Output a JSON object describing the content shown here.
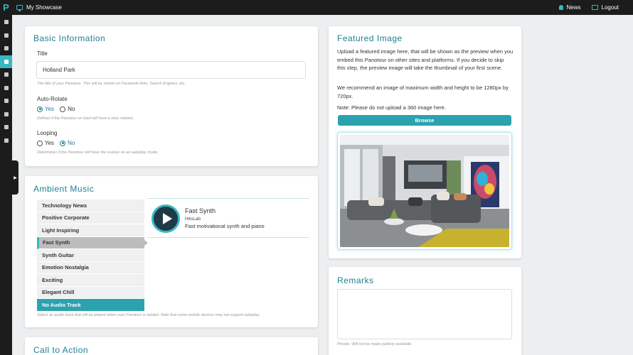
{
  "app": {
    "logo_letter": "P",
    "title": "My Showcase"
  },
  "topbar": {
    "news_label": "News",
    "logout_label": "Logout"
  },
  "sidebar": {
    "icons": [
      "dashboard-icon",
      "user-icon",
      "leaf-icon",
      "inbox-icon",
      "book-icon",
      "trash-icon",
      "home-icon",
      "monitor-icon",
      "info-icon",
      "lock-icon"
    ],
    "active_index": 3
  },
  "basic": {
    "title": "Basic Information",
    "title_label": "Title",
    "title_value": "Holland Park",
    "title_hint": "The title of your Panotour. This will be shown on Facebook links, Search Engines, etc.",
    "autorotate_label": "Auto-Rotate",
    "autorotate_yes": "Yes",
    "autorotate_no": "No",
    "autorotate_hint": "Defines if the Panotour on load will have a slow rotation.",
    "looping_label": "Looping",
    "looping_yes": "Yes",
    "looping_no": "No",
    "looping_hint": "Determines if the Panotour will have the scenes on an autoplay mode."
  },
  "music": {
    "title": "Ambient Music",
    "tracks": [
      "Technology News",
      "Positive Corporate",
      "Light Inspiring",
      "Fast Synth",
      "Synth Guitar",
      "Emotion Nostalgia",
      "Exciting",
      "Elegant Chill",
      "No Audio Track"
    ],
    "selected": "Fast Synth",
    "player": {
      "name": "Fast Synth",
      "artist": "HitsLab",
      "description": "Fast motivational synth and piano"
    },
    "hint": "Select an audio track that will be played when your Panotour is loaded. Note that some mobile devices may not support autoplay."
  },
  "cta": {
    "title": "Call to Action"
  },
  "featured": {
    "title": "Featured Image",
    "paragraph1": "Upload a featured image here, that will be shown as the preview when you embed this Panotour on other sites and platforms. If you decide to skip this step, the preview image will take the thumbnail of your first scene.",
    "paragraph2": "We recommend an image of maximum width and height to be 1280px by 720px.",
    "paragraph3": "Note: Please do not upload a 360 image here.",
    "browse_label": "Browse"
  },
  "remarks": {
    "title": "Remarks",
    "hint": "Private. Will not be made publicly available."
  },
  "colors": {
    "accent": "#37b7c0",
    "heading": "#1f7f8e",
    "topbar": "#1c1c1c"
  }
}
